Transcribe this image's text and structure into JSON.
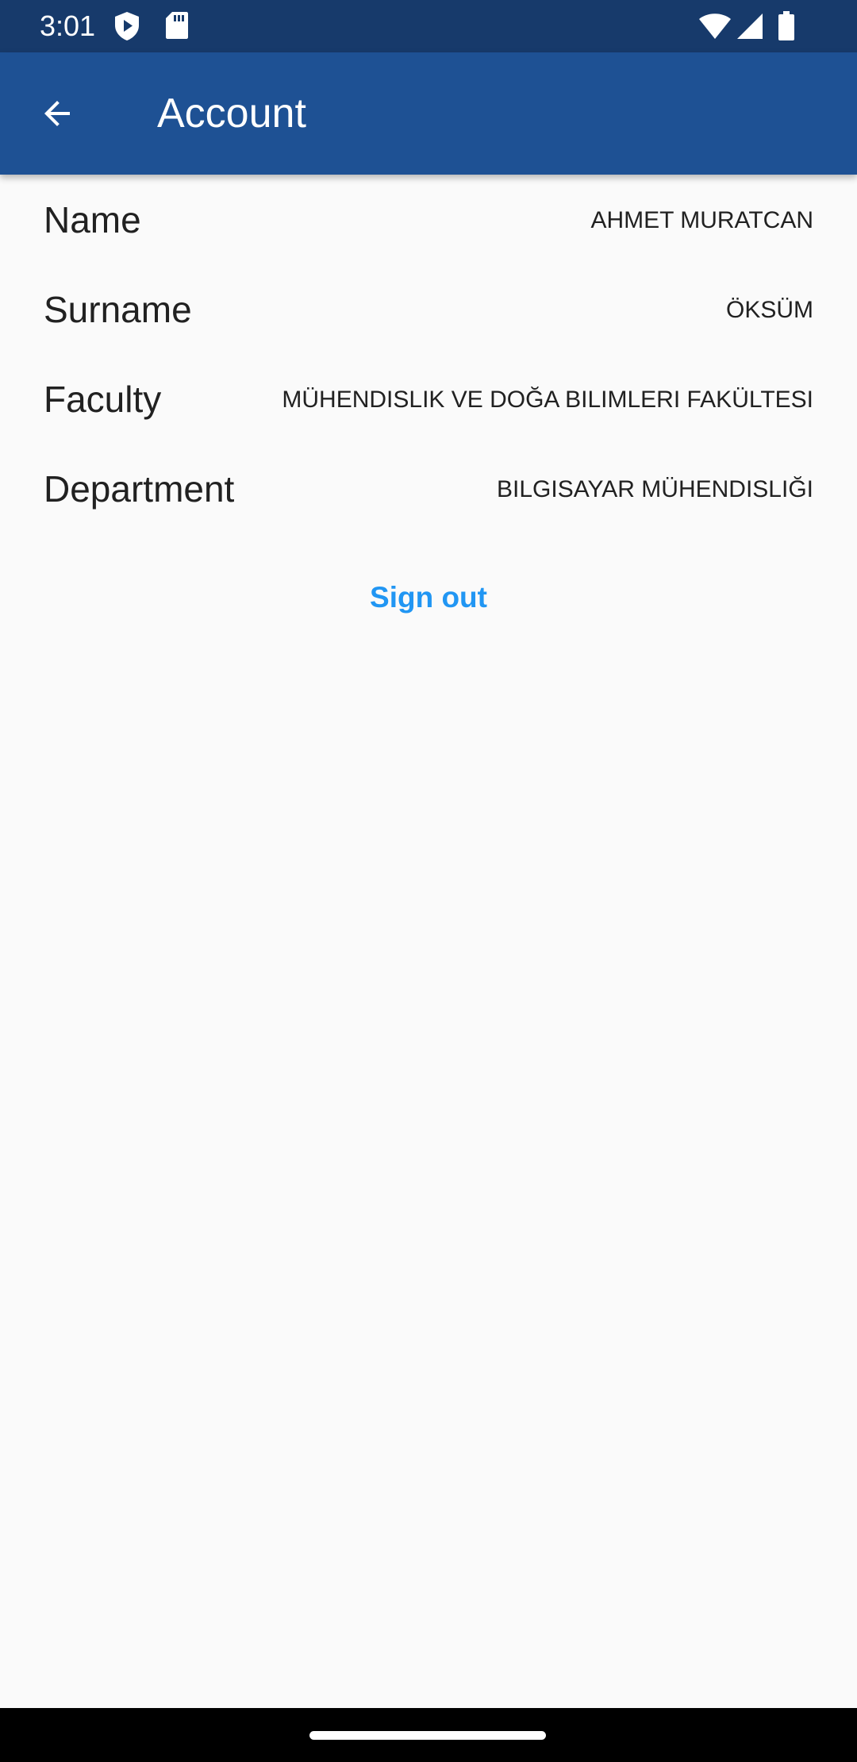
{
  "status_bar": {
    "time": "3:01",
    "icons": [
      "shield-play-icon",
      "sd-card-icon",
      "wifi-icon",
      "cellular-signal-icon",
      "battery-icon"
    ]
  },
  "app_bar": {
    "back_icon": "arrow-back-icon",
    "title": "Account",
    "background_color": "#1e5194"
  },
  "account": {
    "rows": [
      {
        "label": "Name",
        "value": "AHMET MURATCAN"
      },
      {
        "label": "Surname",
        "value": "ÖKSÜM"
      },
      {
        "label": "Faculty",
        "value": "MÜHENDISLIK VE DOĞA BILIMLERI FAKÜLTESI"
      },
      {
        "label": "Department",
        "value": "BILGISAYAR MÜHENDISLIĞI"
      }
    ]
  },
  "actions": {
    "sign_out_label": "Sign out",
    "accent_color": "#2196f3"
  }
}
